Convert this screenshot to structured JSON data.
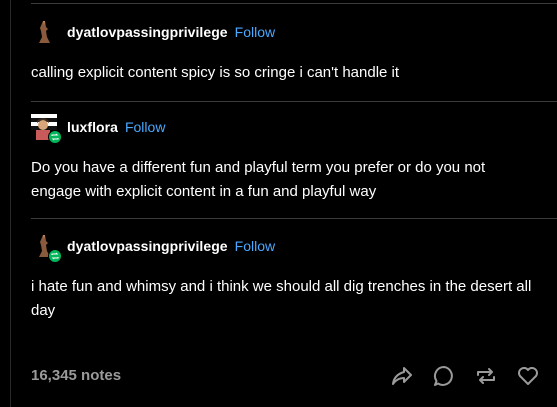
{
  "posts": [
    {
      "username": "dyatlovpassingprivilege",
      "follow_label": "Follow",
      "text": "calling explicit content spicy is so cringe i can't handle it"
    },
    {
      "username": "luxflora",
      "follow_label": "Follow",
      "text": "Do you have a different fun and playful term you prefer or do you not engage with explicit content in a fun and playful way"
    },
    {
      "username": "dyatlovpassingprivilege",
      "follow_label": "Follow",
      "text": "i hate fun and whimsy and i think we should all dig trenches in the desert all day"
    }
  ],
  "footer": {
    "notes": "16,345 notes",
    "actions": [
      "share-icon",
      "reply-icon",
      "reblog-icon",
      "like-icon"
    ]
  },
  "colors": {
    "background": "#000000",
    "text": "#ffffff",
    "follow": "#4aa8ff",
    "notes": "#9a9a9a",
    "reblog_badge": "#00b55a",
    "divider": "#3a3a3a"
  }
}
